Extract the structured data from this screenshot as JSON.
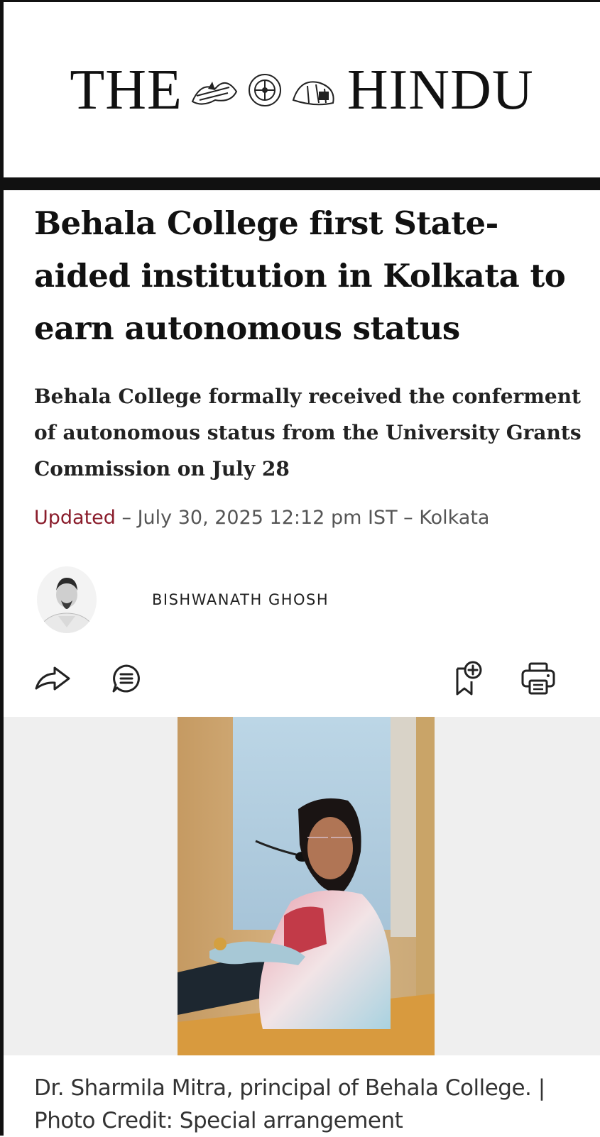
{
  "masthead": {
    "brand_left": "THE",
    "brand_right": "HINDU",
    "crest_icon": "newspaper-crest-emblem"
  },
  "article": {
    "headline": "Behala College first State-aided institution in Kolkata to earn autonomous status",
    "standfirst": "Behala College formally received the conferment of autonomous status from the University Grants Commission on July 28",
    "meta": {
      "updated_label": "Updated",
      "separator": " – ",
      "datetime": "July 30, 2025 12:12 pm IST",
      "location": "Kolkata"
    },
    "author": "BISHWANATH GHOSH"
  },
  "actions": {
    "share_icon": "share-arrow-icon",
    "comments_icon": "comment-bubble-icon",
    "bookmark_icon": "bookmark-add-icon",
    "print_icon": "printer-icon"
  },
  "photo": {
    "caption": "Dr. Sharmila Mitra, principal of Behala College. | Photo Credit: Special arrangement"
  },
  "colors": {
    "updated_accent": "#8a1c2b",
    "photo_background": "#efefef"
  }
}
